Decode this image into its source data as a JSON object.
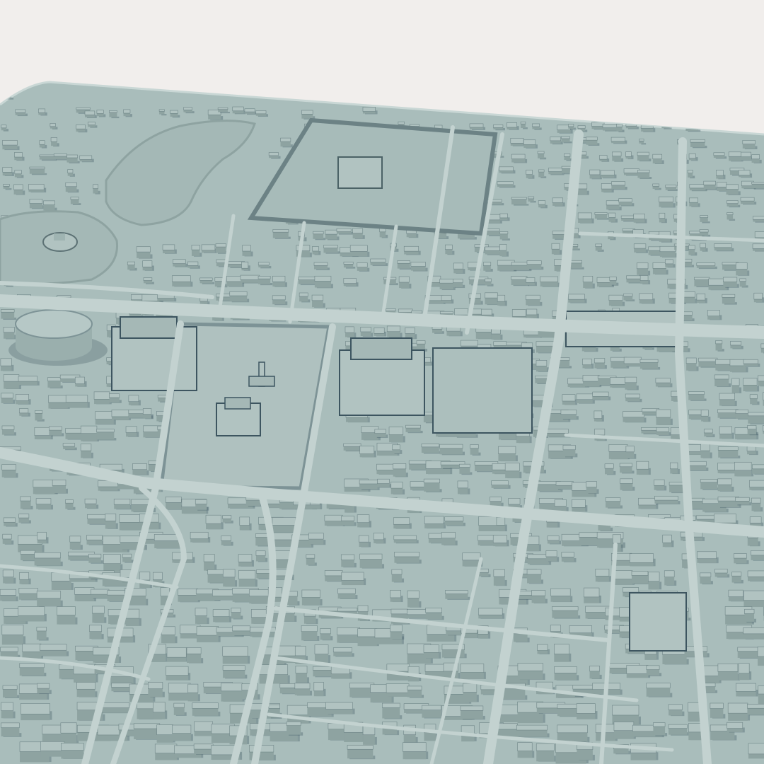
{
  "scene": {
    "subject": "3d-city-model",
    "view": "aerial-oblique",
    "background_color": "#f1eeec",
    "base_color": "#a9bdbb",
    "road_color": "#b8cac8",
    "block_top_color": "#b1c3c1",
    "block_side_color": "#8ea3a1",
    "shadow_color": "#3d5560",
    "water_color": "#a4b8b6"
  }
}
